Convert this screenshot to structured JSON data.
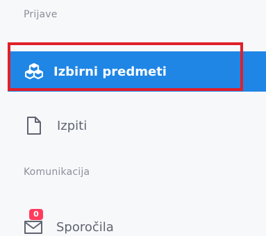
{
  "sidebar": {
    "sections": [
      {
        "label": "Prijave"
      },
      {
        "label": "Komunikacija"
      }
    ],
    "items": [
      {
        "label": "Izbirni predmeti",
        "icon": "cubes-icon",
        "active": true
      },
      {
        "label": "Izpiti",
        "icon": "document-icon",
        "active": false
      },
      {
        "label": "Sporočila",
        "icon": "envelope-icon",
        "active": false,
        "badge": "0"
      }
    ]
  },
  "colors": {
    "active_bg": "#1f86e5",
    "highlight": "#e0202a",
    "badge": "#ff3b5c",
    "text_muted": "#8b8f99",
    "text_item": "#5f6470"
  }
}
